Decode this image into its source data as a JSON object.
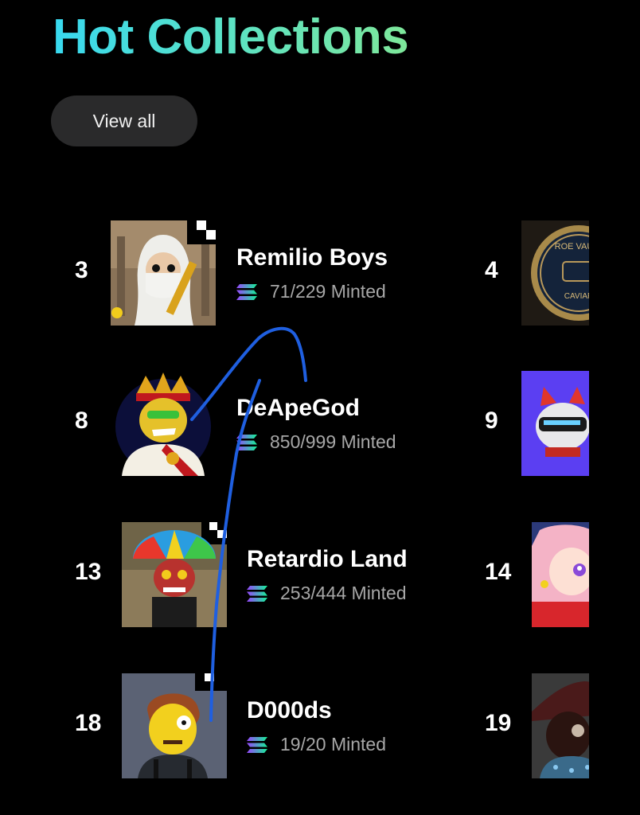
{
  "header": {
    "title": "Hot Collections",
    "view_all_label": "View all"
  },
  "collections_left": [
    {
      "rank": "3",
      "name": "Remilio Boys",
      "minted": "71/229 Minted",
      "thumb_icon": "remilio-boys-thumbnail"
    },
    {
      "rank": "8",
      "name": "DeApeGod",
      "minted": "850/999 Minted",
      "thumb_icon": "deapegod-thumbnail"
    },
    {
      "rank": "13",
      "name": "Retardio Land",
      "minted": "253/444 Minted",
      "thumb_icon": "retardio-land-thumbnail"
    },
    {
      "rank": "18",
      "name": "D000ds",
      "minted": "19/20 Minted",
      "thumb_icon": "d000ds-thumbnail"
    }
  ],
  "collections_right": [
    {
      "rank": "4",
      "thumb_icon": "roe-vault-caviar-thumbnail",
      "thumb_text_top": "ROE VAULT",
      "thumb_text_bottom": "CAVIAR"
    },
    {
      "rank": "9",
      "thumb_icon": "robot-knight-thumbnail"
    },
    {
      "rank": "14",
      "thumb_icon": "anime-girl-thumbnail"
    },
    {
      "rank": "19",
      "thumb_icon": "hat-character-thumbnail"
    }
  ],
  "chain_icon": "solana-icon",
  "colors": {
    "background": "#000000",
    "title_gradient_start": "#38d9f0",
    "title_gradient_end": "#7ee79a",
    "button_bg": "#2a2a2b",
    "secondary_text": "#a7a7a7",
    "scribble": "#1f5fe0"
  }
}
